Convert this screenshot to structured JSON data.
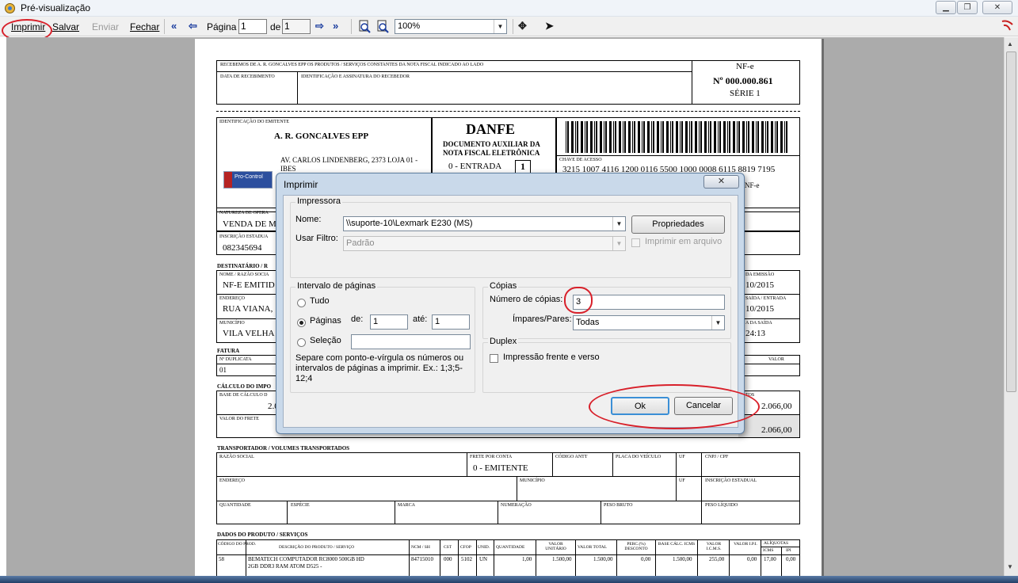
{
  "window": {
    "title": "Pré-visualização"
  },
  "toolbar": {
    "print": "Imprimir",
    "save": "Salvar",
    "send": "Enviar",
    "close": "Fechar",
    "page_label": "Página",
    "page_value": "1",
    "of_label": "de",
    "of_value": "1",
    "zoom": "100%"
  },
  "danfe": {
    "receipt": {
      "header": "RECEBEMOS DE A. R. GONCALVES EPP OS PRODUTOS / SERVIÇOS CONSTANTES DA NOTA FISCAL INDICADO AO LADO",
      "date_label": "DATA DE RECEBIMENTO",
      "sign_label": "IDENTIFICAÇÃO E ASSINATURA DO RECEBEDOR",
      "nfe": "NF-e",
      "number": "Nº 000.000.861",
      "series": "SÉRIE 1"
    },
    "issuer": {
      "label": "IDENTIFICAÇÃO DO EMITENTE",
      "name": "A. R. GONCALVES EPP",
      "address": "AV. CARLOS LINDENBERG, 2373 LOJA 01 -",
      "address2": "IBES",
      "logo_text": "Pro-Control"
    },
    "danfe_block": {
      "title": "DANFE",
      "subtitle1": "DOCUMENTO AUXILIAR DA",
      "subtitle2": "NOTA FISCAL ELETRÔNICA",
      "entry": "0 - ENTRADA",
      "entry_box": "1"
    },
    "access_key": {
      "label": "CHAVE DE ACESSO",
      "value": "3215 1007 4116 1200 0116 5500 1000 0008 6115 8819 7195",
      "right_fragment": "NF-e"
    },
    "operation": {
      "label": "NATUREZA DE OPERA",
      "value": "VENDA DE M"
    },
    "state_reg": {
      "label": "INSCRIÇÃO ESTADUA",
      "value": "082345694"
    },
    "recipient": {
      "section": "DESTINATÁRIO / R",
      "name_label": "NOME / RAZÃO SOCIA",
      "name": "NF-E EMITID",
      "addr_label": "ENDEREÇO",
      "addr": "RUA VIANA,",
      "city_label": "MUNICÍPIO",
      "city": "VILA VELHA",
      "emission_label": "DA EMISSÃO",
      "emission": "10/2015",
      "exit_label": "SAÍDA / ENTRADA",
      "exit": "10/2015",
      "time_label": "A DA SAÍDA",
      "time": "24:13"
    },
    "invoice": {
      "section": "FATURA",
      "dup_label": "Nº DUPLICATA",
      "dup_value": "01",
      "value_label": "VALOR"
    },
    "tax": {
      "section": "CÁLCULO DO IMPO",
      "base_label": "BASE DE CÁLCULO D",
      "base_value": "2.0",
      "freight_label": "VALOR DO FRETE",
      "total_label": "TOS",
      "total1": "2.066,00",
      "total2": "2.066,00"
    },
    "transport": {
      "section": "TRANSPORTADOR / VOLUMES TRANSPORTADOS",
      "razao": "RAZÃO SOCIAL",
      "frete_label": "FRETE POR CONTA",
      "frete_value": "0 - EMITENTE",
      "antt": "CÓDIGO ANTT",
      "placa": "PLACA DO VEÍCULO",
      "uf": "UF",
      "cnpj": "CNPJ / CPF",
      "endereco": "ENDEREÇO",
      "municipio": "MUNICÍPIO",
      "uf2": "UF",
      "ie": "INSCRIÇÃO ESTADUAL",
      "quantidade": "QUANTIDADE",
      "especie": "ESPÉCIE",
      "marca": "MARCA",
      "numeracao": "NUMERAÇÃO",
      "peso_bruto": "PESO BRUTO",
      "peso_liquido": "PESO LÍQUIDO"
    },
    "products": {
      "section": "DADOS DO PRODUTO / SERVIÇOS",
      "headers": [
        "CÓDIGO DO PROD.",
        "DESCRIÇÃO DO PRODUTO / SERVIÇO",
        "NCM / SH",
        "CST",
        "CFOP",
        "UNID.",
        "QUANTIDADE",
        "VALOR UNITÁRIO",
        "VALOR TOTAL",
        "PERC.(%) DESCONTO",
        "BASE CÁLC. ICMS",
        "VALOR I.C.M.S.",
        "VALOR I.P.I.",
        "ALÍQUOTAS",
        "ICMS",
        "IPI"
      ],
      "row": [
        "58",
        "BEMATECH COMPUTADOR RC8000 500GB HD",
        "84715010",
        "000",
        "5102",
        "UN",
        "1,00",
        "1.500,00",
        "1.500,00",
        "0,00",
        "1.500,00",
        "255,00",
        "0,00",
        "17,00",
        "0,00"
      ],
      "row_line2": "2GB DDR3 RAM ATOM D525 -"
    }
  },
  "print_dialog": {
    "title": "Imprimir",
    "close_glyph": "✕",
    "printer_group": "Impressora",
    "name_label": "Nome:",
    "printer_name": "\\\\suporte-10\\Lexmark E230 (MS)",
    "properties_button": "Propriedades",
    "filter_label": "Usar Filtro:",
    "filter_value": "Padrão",
    "print_to_file": "Imprimir em arquivo",
    "range_group": "Intervalo de páginas",
    "all": "Tudo",
    "pages": "Páginas",
    "from_label": "de:",
    "from_value": "1",
    "to_label": "até:",
    "to_value": "1",
    "selection": "Seleção",
    "hint": "Separe com ponto-e-vírgula os números ou intervalos de páginas a imprimir. Ex.: 1;3;5-12;4",
    "copies_group": "Cópias",
    "copies_label": "Número de cópias:",
    "copies_value": "3",
    "odd_even_label": "Ímpares/Pares:",
    "odd_even_value": "Todas",
    "duplex_group": "Duplex",
    "duplex_label": "Impressão frente e verso",
    "ok_button": "Ok",
    "cancel_button": "Cancelar"
  }
}
